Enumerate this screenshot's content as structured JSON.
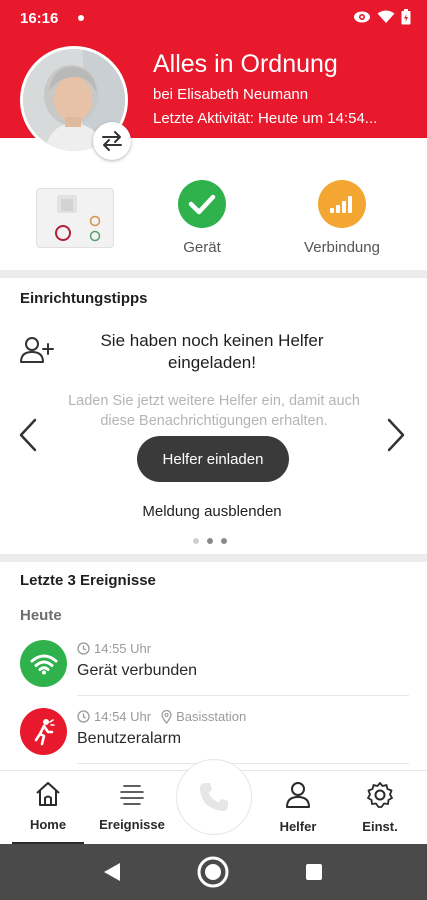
{
  "status_bar": {
    "time": "16:16"
  },
  "header": {
    "title": "Alles in Ordnung",
    "subtitle": "bei Elisabeth Neumann",
    "last_activity": "Letzte Aktivität: Heute um 14:54..."
  },
  "device_status": {
    "items": [
      {
        "label": "Gerät",
        "icon": "check-icon",
        "color": "#2fb24c"
      },
      {
        "label": "Verbindung",
        "icon": "signal-bars-icon",
        "color": "#f3a732"
      }
    ]
  },
  "tips": {
    "title": "Einrichtungstipps",
    "heading": "Sie haben noch keinen Helfer eingeladen!",
    "body": "Laden Sie jetzt weitere Helfer ein, damit auch diese Benachrichtigungen erhalten.",
    "button": "Helfer einladen",
    "hide_link": "Meldung ausblenden",
    "page_index": 2,
    "page_count": 3
  },
  "events": {
    "title": "Letzte 3 Ereignisse",
    "day": "Heute",
    "items": [
      {
        "time": "14:55 Uhr",
        "location": "",
        "title": "Gerät verbunden",
        "icon": "wifi-icon",
        "color": "#2fb24c"
      },
      {
        "time": "14:54 Uhr",
        "location": "Basisstation",
        "title": "Benutzeralarm",
        "icon": "person-alarm-icon",
        "color": "#e8192c"
      }
    ]
  },
  "nav": {
    "items": [
      {
        "label": "Home",
        "icon": "home-icon",
        "active": true
      },
      {
        "label": "Ereignisse",
        "icon": "list-icon",
        "active": false
      },
      {
        "label": "Helfer",
        "icon": "person-icon",
        "active": false
      },
      {
        "label": "Einst.",
        "icon": "gear-icon",
        "active": false
      }
    ],
    "center_icon": "phone-icon"
  },
  "colors": {
    "brand_red": "#e8192c",
    "ok_green": "#2fb24c",
    "warn_orange": "#f3a732",
    "button_dark": "#3a3a3a"
  }
}
